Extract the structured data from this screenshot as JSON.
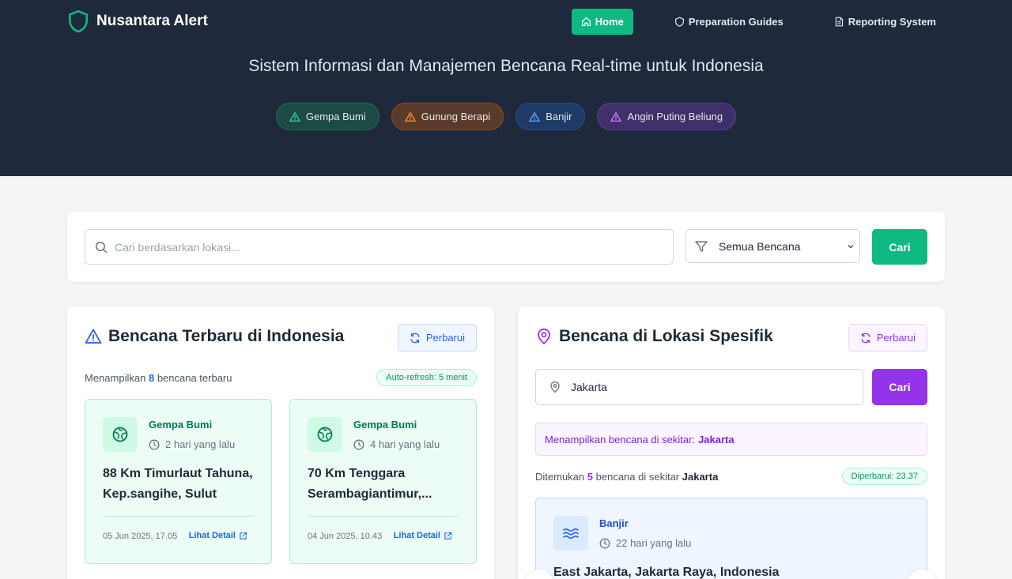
{
  "header": {
    "brand": "Nusantara Alert",
    "nav": [
      {
        "label": "Home",
        "active": true,
        "icon": "home-icon"
      },
      {
        "label": "Preparation Guides",
        "active": false,
        "icon": "shield-icon"
      },
      {
        "label": "Reporting System",
        "active": false,
        "icon": "document-icon"
      }
    ]
  },
  "hero": {
    "subtitle": "Sistem Informasi dan Manajemen Bencana Real-time untuk Indonesia",
    "chips": [
      {
        "label": "Gempa Bumi",
        "color": "#34d399"
      },
      {
        "label": "Gunung Berapi",
        "color": "#fb923c"
      },
      {
        "label": "Banjir",
        "color": "#60a5fa"
      },
      {
        "label": "Angin Puting Beliung",
        "color": "#c084fc"
      }
    ]
  },
  "search": {
    "placeholder": "Cari berdasarkan lokasi...",
    "value": "",
    "filter_value": "Semua Bencana",
    "button": "Cari"
  },
  "latest": {
    "title": "Bencana Terbaru di Indonesia",
    "refresh": "Perbarui",
    "showing_prefix": "Menampilkan",
    "count": "8",
    "showing_suffix": "bencana terbaru",
    "auto_refresh": "Auto-refresh: 5 menit",
    "events": [
      {
        "type": "Gempa Bumi",
        "ago": "2 hari yang lalu",
        "title": "88 Km Timurlaut Tahuna, Kep.sangihe, Sulut",
        "date": "05 Jun 2025, 17.05",
        "link": "Lihat Detail"
      },
      {
        "type": "Gempa Bumi",
        "ago": "4 hari yang lalu",
        "title": "70 Km Tenggara Serambagiantimur,...",
        "date": "04 Jun 2025, 10.43",
        "link": "Lihat Detail"
      }
    ]
  },
  "location": {
    "title": "Bencana di Lokasi Spesifik",
    "refresh": "Perbarui",
    "input_value": "Jakarta",
    "button": "Cari",
    "info_prefix": "Menampilkan bencana di sekitar:",
    "info_location": "Jakarta",
    "found_prefix": "Ditemukan",
    "found_count": "5",
    "found_middle": "bencana di sekitar",
    "found_location": "Jakarta",
    "updated": "Diperbarui: 23.37",
    "events": [
      {
        "type": "Banjir",
        "ago": "22 hari yang lalu",
        "title": "East Jakarta, Jakarta Raya, Indonesia"
      }
    ]
  },
  "colors": {
    "hero_bg": "#1e293b",
    "accent_green": "#10b981",
    "accent_purple": "#9333ea",
    "accent_blue": "#2563eb"
  }
}
